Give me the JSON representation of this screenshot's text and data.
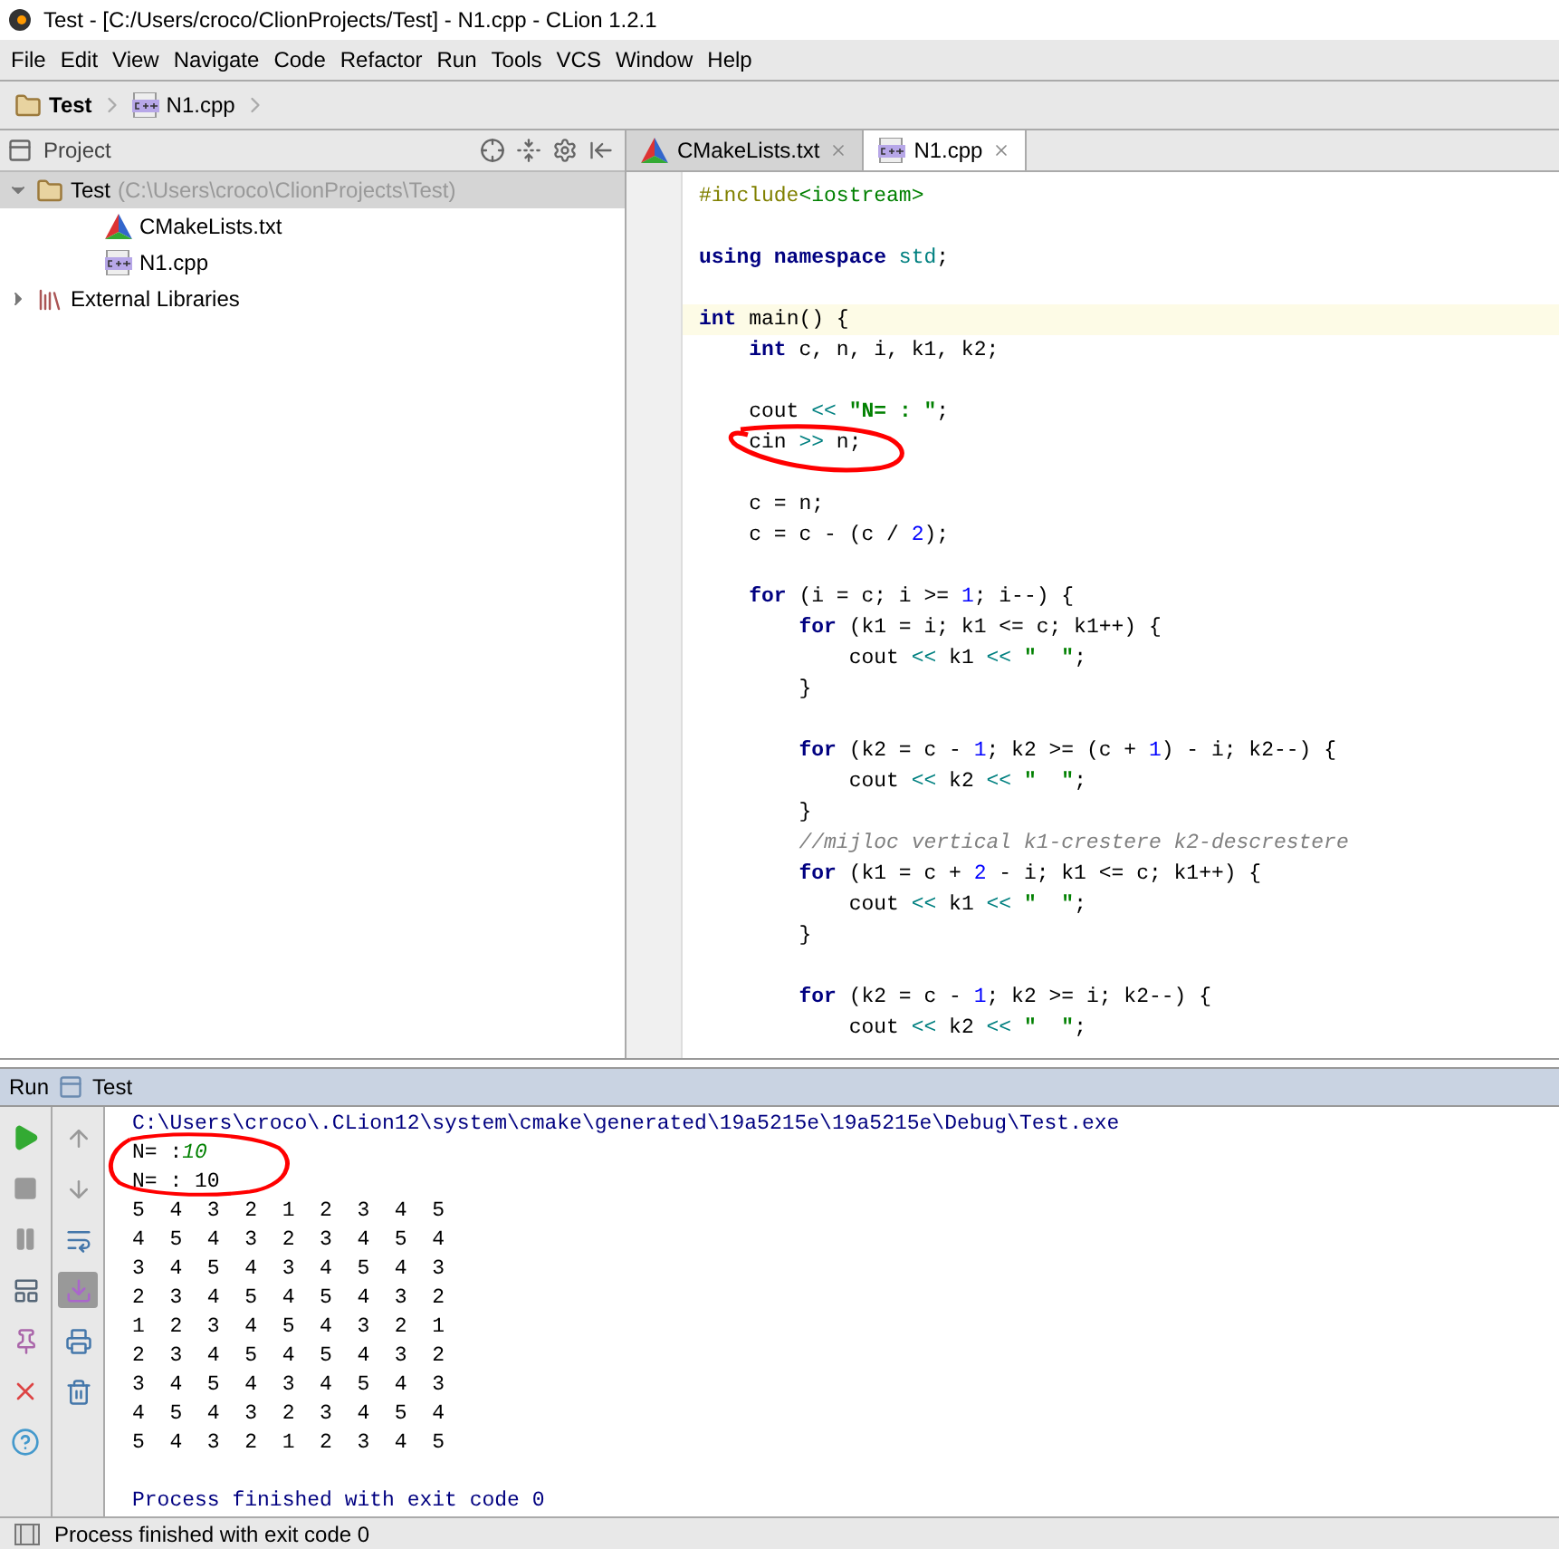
{
  "window": {
    "title": "Test - [C:/Users/croco/ClionProjects/Test] - N1.cpp - CLion 1.2.1"
  },
  "menu": [
    "File",
    "Edit",
    "View",
    "Navigate",
    "Code",
    "Refactor",
    "Run",
    "Tools",
    "VCS",
    "Window",
    "Help"
  ],
  "breadcrumb": [
    {
      "label": "Test",
      "kind": "folder"
    },
    {
      "label": "N1.cpp",
      "kind": "cpp"
    }
  ],
  "project_panel": {
    "title": "Project",
    "tree": [
      {
        "label": "Test",
        "path": "(C:\\Users\\croco\\ClionProjects\\Test)",
        "kind": "folder",
        "expanded": true,
        "selected": true,
        "children": [
          {
            "label": "CMakeLists.txt",
            "kind": "cmake",
            "selected": false
          },
          {
            "label": "N1.cpp",
            "kind": "cpp",
            "selected": false
          }
        ]
      },
      {
        "label": "External Libraries",
        "kind": "library",
        "expanded": false,
        "selected": false
      }
    ]
  },
  "editor": {
    "tabs": [
      {
        "label": "CMakeLists.txt",
        "kind": "cmake",
        "selected": false
      },
      {
        "label": "N1.cpp",
        "kind": "cpp",
        "selected": true
      }
    ],
    "lines": [
      {
        "current": false,
        "tokens": [
          {
            "kind": "pre",
            "text": "#include"
          },
          {
            "kind": "header",
            "text": "<iostream>"
          }
        ]
      },
      {
        "current": false
      },
      {
        "current": false,
        "tokens": [
          {
            "kind": "kw",
            "text": "using namespace "
          },
          {
            "kind": "op",
            "text": "std"
          },
          {
            "kind": "plain",
            "text": ";"
          }
        ]
      },
      {
        "current": false
      },
      {
        "current": true,
        "tokens": [
          {
            "kind": "kw",
            "text": "int "
          },
          {
            "kind": "plain",
            "text": "main() {"
          }
        ]
      },
      {
        "current": false,
        "tokens": [
          {
            "kind": "kw",
            "text": "    int "
          },
          {
            "kind": "plain",
            "text": "c, n, i, k1, k2;"
          }
        ]
      },
      {
        "current": false
      },
      {
        "current": false,
        "tokens": [
          {
            "kind": "plain",
            "text": "    cout "
          },
          {
            "kind": "op",
            "text": "<<"
          },
          {
            "kind": "str",
            "text": " \"N= : \""
          },
          {
            "kind": "plain",
            "text": ";"
          }
        ]
      },
      {
        "current": false,
        "tokens": [
          {
            "kind": "plain",
            "text": "    cin "
          },
          {
            "kind": "op",
            "text": ">>"
          },
          {
            "kind": "plain",
            "text": " n;"
          }
        ]
      },
      {
        "current": false
      },
      {
        "current": false,
        "tokens": [
          {
            "kind": "plain",
            "text": "    c = n;"
          }
        ]
      },
      {
        "current": false,
        "tokens": [
          {
            "kind": "plain",
            "text": "    c = c - (c / "
          },
          {
            "kind": "num",
            "text": "2"
          },
          {
            "kind": "plain",
            "text": ");"
          }
        ]
      },
      {
        "current": false
      },
      {
        "current": false,
        "tokens": [
          {
            "kind": "kw",
            "text": "    for"
          },
          {
            "kind": "plain",
            "text": " (i = c; i >= "
          },
          {
            "kind": "num",
            "text": "1"
          },
          {
            "kind": "plain",
            "text": "; i--) {"
          }
        ]
      },
      {
        "current": false,
        "tokens": [
          {
            "kind": "kw",
            "text": "        for"
          },
          {
            "kind": "plain",
            "text": " (k1 = i; k1 <= c; k1++) {"
          }
        ]
      },
      {
        "current": false,
        "tokens": [
          {
            "kind": "plain",
            "text": "            cout "
          },
          {
            "kind": "op",
            "text": "<<"
          },
          {
            "kind": "plain",
            "text": " k1 "
          },
          {
            "kind": "op",
            "text": "<<"
          },
          {
            "kind": "str",
            "text": " \"  \""
          },
          {
            "kind": "plain",
            "text": ";"
          }
        ]
      },
      {
        "current": false,
        "tokens": [
          {
            "kind": "plain",
            "text": "        }"
          }
        ]
      },
      {
        "current": false
      },
      {
        "current": false,
        "tokens": [
          {
            "kind": "kw",
            "text": "        for"
          },
          {
            "kind": "plain",
            "text": " (k2 = c - "
          },
          {
            "kind": "num",
            "text": "1"
          },
          {
            "kind": "plain",
            "text": "; k2 >= (c + "
          },
          {
            "kind": "num",
            "text": "1"
          },
          {
            "kind": "plain",
            "text": ") - i; k2--) {"
          }
        ]
      },
      {
        "current": false,
        "tokens": [
          {
            "kind": "plain",
            "text": "            cout "
          },
          {
            "kind": "op",
            "text": "<<"
          },
          {
            "kind": "plain",
            "text": " k2 "
          },
          {
            "kind": "op",
            "text": "<<"
          },
          {
            "kind": "str",
            "text": " \"  \""
          },
          {
            "kind": "plain",
            "text": ";"
          }
        ]
      },
      {
        "current": false,
        "tokens": [
          {
            "kind": "plain",
            "text": "        }"
          }
        ]
      },
      {
        "current": false,
        "tokens": [
          {
            "kind": "comment",
            "text": "        //mijloc vertical k1-crestere k2-descrestere"
          }
        ]
      },
      {
        "current": false,
        "tokens": [
          {
            "kind": "kw",
            "text": "        for"
          },
          {
            "kind": "plain",
            "text": " (k1 = c + "
          },
          {
            "kind": "num",
            "text": "2"
          },
          {
            "kind": "plain",
            "text": " - i; k1 <= c; k1++) {"
          }
        ]
      },
      {
        "current": false,
        "tokens": [
          {
            "kind": "plain",
            "text": "            cout "
          },
          {
            "kind": "op",
            "text": "<<"
          },
          {
            "kind": "plain",
            "text": " k1 "
          },
          {
            "kind": "op",
            "text": "<<"
          },
          {
            "kind": "str",
            "text": " \"  \""
          },
          {
            "kind": "plain",
            "text": ";"
          }
        ]
      },
      {
        "current": false,
        "tokens": [
          {
            "kind": "plain",
            "text": "        }"
          }
        ]
      },
      {
        "current": false
      },
      {
        "current": false,
        "tokens": [
          {
            "kind": "kw",
            "text": "        for"
          },
          {
            "kind": "plain",
            "text": " (k2 = c - "
          },
          {
            "kind": "num",
            "text": "1"
          },
          {
            "kind": "plain",
            "text": "; k2 >= i; k2--) {"
          }
        ]
      },
      {
        "current": false,
        "tokens": [
          {
            "kind": "plain",
            "text": "            cout "
          },
          {
            "kind": "op",
            "text": "<<"
          },
          {
            "kind": "plain",
            "text": " k2 "
          },
          {
            "kind": "op",
            "text": "<<"
          },
          {
            "kind": "str",
            "text": " \"  \""
          },
          {
            "kind": "plain",
            "text": ";"
          }
        ]
      }
    ]
  },
  "run_panel": {
    "title": "Run",
    "config": "Test",
    "output": [
      {
        "kind": "line",
        "tokens": [
          {
            "kind": "system",
            "text": "C:\\Users\\croco\\.CLion12\\system\\cmake\\generated\\19a5215e\\19a5215e\\Debug\\Test.exe"
          }
        ]
      },
      {
        "kind": "line",
        "tokens": [
          {
            "kind": "plain",
            "text": "N= :"
          },
          {
            "kind": "input",
            "text": "10"
          }
        ]
      },
      {
        "kind": "line",
        "tokens": [
          {
            "kind": "plain",
            "text": "N= : 10"
          }
        ]
      },
      {
        "kind": "line",
        "tokens": [
          {
            "kind": "plain",
            "text": "5  4  3  2  1  2  3  4  5"
          }
        ]
      },
      {
        "kind": "line",
        "tokens": [
          {
            "kind": "plain",
            "text": "4  5  4  3  2  3  4  5  4"
          }
        ]
      },
      {
        "kind": "line",
        "tokens": [
          {
            "kind": "plain",
            "text": "3  4  5  4  3  4  5  4  3"
          }
        ]
      },
      {
        "kind": "line",
        "tokens": [
          {
            "kind": "plain",
            "text": "2  3  4  5  4  5  4  3  2"
          }
        ]
      },
      {
        "kind": "line",
        "tokens": [
          {
            "kind": "plain",
            "text": "1  2  3  4  5  4  3  2  1"
          }
        ]
      },
      {
        "kind": "line",
        "tokens": [
          {
            "kind": "plain",
            "text": "2  3  4  5  4  5  4  3  2"
          }
        ]
      },
      {
        "kind": "line",
        "tokens": [
          {
            "kind": "plain",
            "text": "3  4  5  4  3  4  5  4  3"
          }
        ]
      },
      {
        "kind": "line",
        "tokens": [
          {
            "kind": "plain",
            "text": "4  5  4  3  2  3  4  5  4"
          }
        ]
      },
      {
        "kind": "line",
        "tokens": [
          {
            "kind": "plain",
            "text": "5  4  3  2  1  2  3  4  5"
          }
        ]
      },
      {
        "kind": "summary",
        "tokens": [
          {
            "kind": "system",
            "text": "Process finished with exit code 0"
          }
        ]
      }
    ]
  },
  "status_bar": {
    "text": "Process finished with exit code 0"
  }
}
